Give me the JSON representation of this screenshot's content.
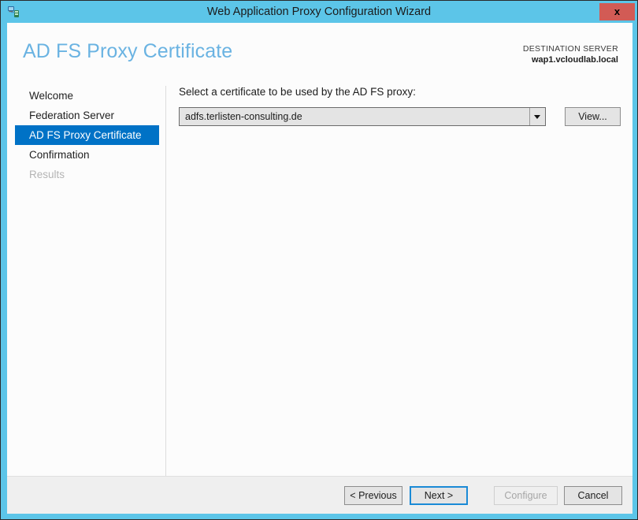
{
  "window": {
    "title": "Web Application Proxy Configuration Wizard",
    "icon": "network-server-icon",
    "close_label": "x",
    "frame_color": "#5cc5e8",
    "close_color": "#d25b55"
  },
  "header": {
    "page_title": "AD FS Proxy Certificate",
    "title_color": "#6ab3e2",
    "destination_label": "DESTINATION SERVER",
    "destination_value": "wap1.vcloudlab.local"
  },
  "sidebar": {
    "accent_color": "#0072c6",
    "items": [
      {
        "label": "Welcome",
        "state": "normal"
      },
      {
        "label": "Federation Server",
        "state": "normal"
      },
      {
        "label": "AD FS Proxy Certificate",
        "state": "selected"
      },
      {
        "label": "Confirmation",
        "state": "normal"
      },
      {
        "label": "Results",
        "state": "disabled"
      }
    ]
  },
  "main": {
    "certificate_prompt": "Select a certificate to be used by the AD FS proxy:",
    "certificate_select": {
      "value": "adfs.terlisten-consulting.de",
      "options": [
        "adfs.terlisten-consulting.de"
      ],
      "arrow_icon": "chevron-down-icon"
    },
    "view_button_label": "View..."
  },
  "footer": {
    "previous_label": "< Previous",
    "next_label": "Next >",
    "configure_label": "Configure",
    "cancel_label": "Cancel",
    "focus_color": "#1a8ad6"
  }
}
